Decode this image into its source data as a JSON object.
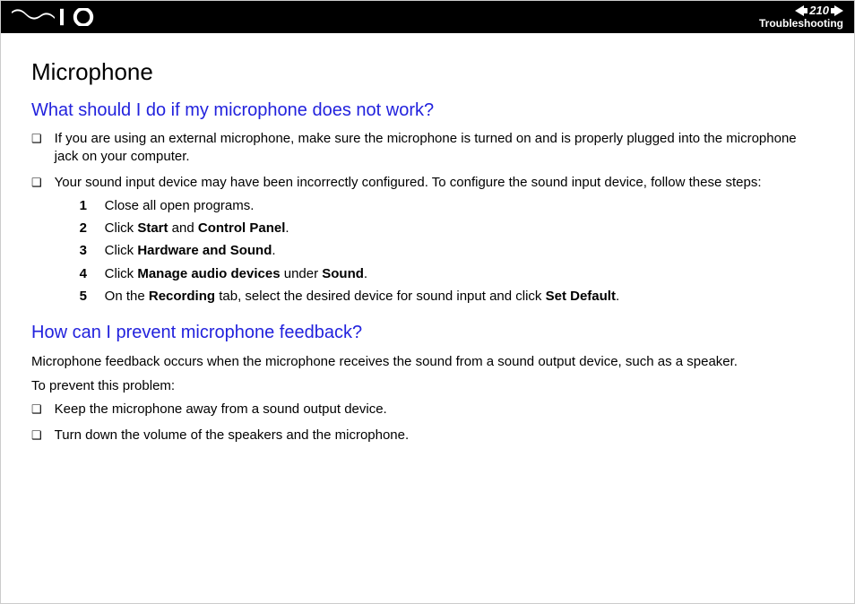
{
  "header": {
    "page_number": "210",
    "section": "Troubleshooting"
  },
  "title": "Microphone",
  "q1": {
    "heading": "What should I do if my microphone does not work?",
    "bullet1": "If you are using an external microphone, make sure the microphone is turned on and is properly plugged into the microphone jack on your computer.",
    "bullet2": "Your sound input device may have been incorrectly configured. To configure the sound input device, follow these steps:",
    "steps": {
      "s1": "Close all open programs.",
      "s2_pre": "Click ",
      "s2_b1": "Start",
      "s2_mid": " and ",
      "s2_b2": "Control Panel",
      "s2_post": ".",
      "s3_pre": "Click ",
      "s3_b1": "Hardware and Sound",
      "s3_post": ".",
      "s4_pre": "Click ",
      "s4_b1": "Manage audio devices",
      "s4_mid": " under ",
      "s4_b2": "Sound",
      "s4_post": ".",
      "s5_pre": "On the ",
      "s5_b1": "Recording",
      "s5_mid": " tab, select the desired device for sound input and click ",
      "s5_b2": "Set Default",
      "s5_post": "."
    }
  },
  "q2": {
    "heading": "How can I prevent microphone feedback?",
    "para1": "Microphone feedback occurs when the microphone receives the sound from a sound output device, such as a speaker.",
    "para2": "To prevent this problem:",
    "bullet1": "Keep the microphone away from a sound output device.",
    "bullet2": "Turn down the volume of the speakers and the microphone."
  }
}
